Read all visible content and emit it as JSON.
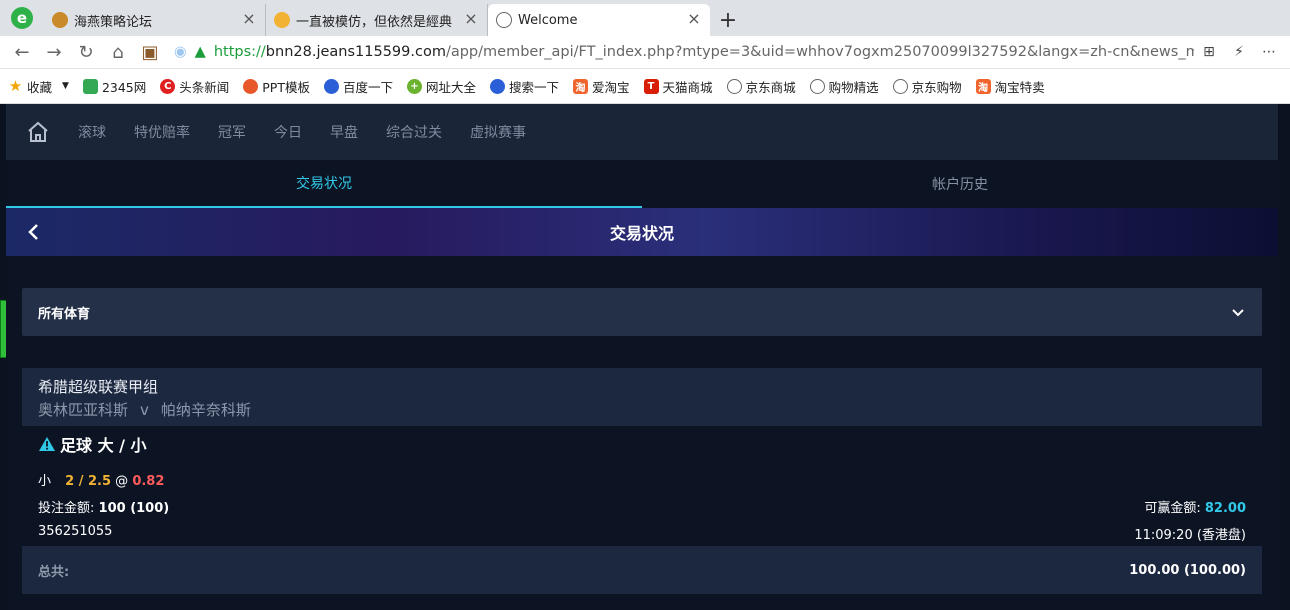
{
  "browser": {
    "tabs": [
      {
        "title": "海燕策略论坛",
        "active": false
      },
      {
        "title": "一直被模仿，但依然是經典",
        "active": false
      },
      {
        "title": "Welcome",
        "active": true
      }
    ],
    "url": {
      "scheme": "https://",
      "host": "bnn28.jeans115599.com",
      "path": "/app/member_api/FT_index.php?mtype=3&uid=whhov7ogxm25070099l327592&langx=zh-cn&news_mem=Y&"
    },
    "bookmarks": [
      "收藏",
      "2345网",
      "头条新闻",
      "PPT模板",
      "百度一下",
      "网址大全",
      "搜索一下",
      "爱淘宝",
      "天猫商城",
      "京东商城",
      "购物精选",
      "京东购物",
      "淘宝特卖"
    ]
  },
  "nav": {
    "items": [
      "滚球",
      "特优赔率",
      "冠军",
      "今日",
      "早盘",
      "综合过关",
      "虚拟赛事"
    ]
  },
  "subtabs": {
    "left": "交易状况",
    "right": "帐户历史"
  },
  "banner": {
    "title": "交易状况"
  },
  "filter": {
    "label": "所有体育"
  },
  "bet": {
    "league": "希腊超级联赛甲组",
    "home": "奥林匹亚科斯",
    "vs": "v",
    "away": "帕纳辛奈科斯",
    "type": "足球 大 / 小",
    "selection": "小",
    "handicap": "2 / 2.5",
    "at": "@",
    "odds": "0.82",
    "stake_label": "投注金额:",
    "stake_value": "100 (100)",
    "win_label": "可赢金额:",
    "win_value": "82.00",
    "ticket": "356251055",
    "time": "11:09:20 (香港盘)"
  },
  "total": {
    "label": "总共:",
    "value": "100.00 (100.00)"
  }
}
